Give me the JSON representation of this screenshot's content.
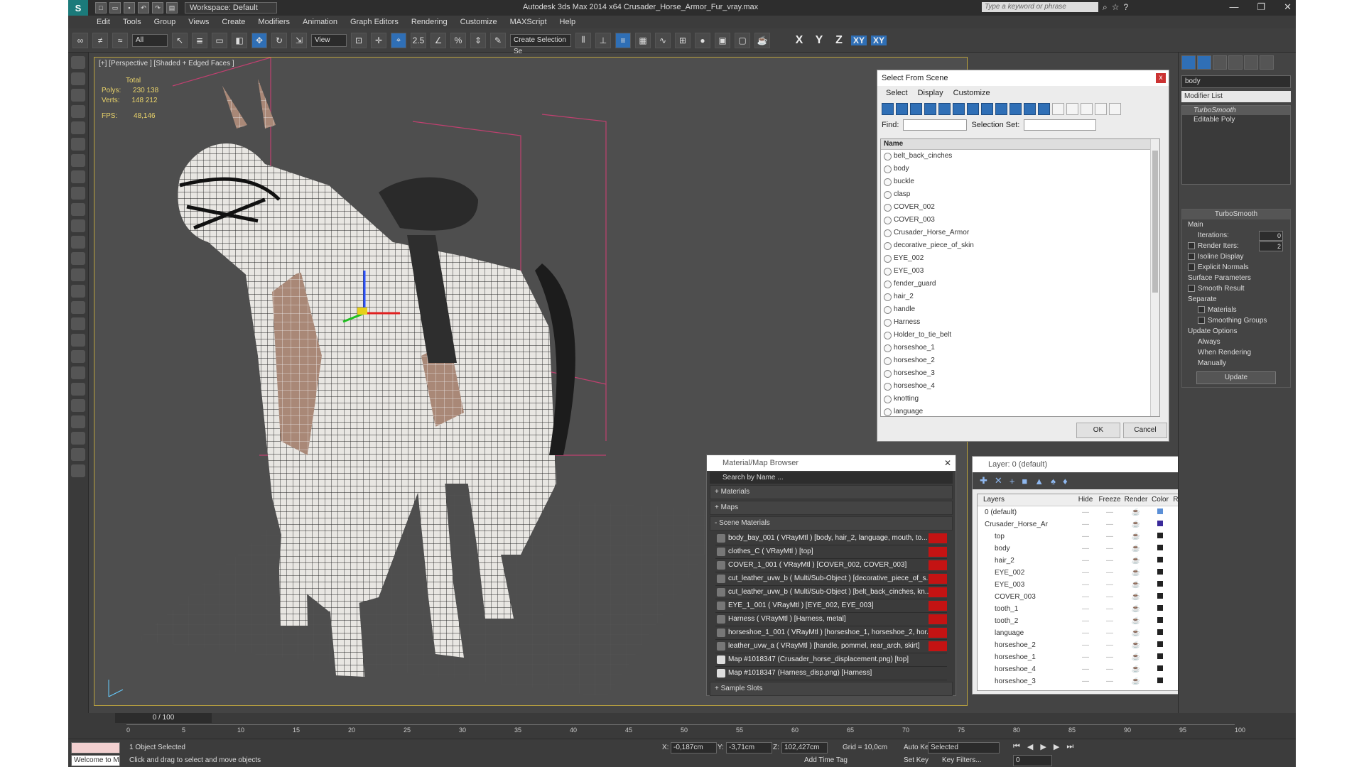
{
  "app": {
    "logo": "S",
    "workspace_label": "Workspace: Default",
    "title": "Autodesk 3ds Max  2014 x64     Crusader_Horse_Armor_Fur_vray.max",
    "search_placeholder": "Type a keyword or phrase",
    "titlebar_icons": [
      "binoculars-icon",
      "star-icon",
      "help-icon"
    ]
  },
  "menu": [
    "Edit",
    "Tools",
    "Group",
    "Views",
    "Create",
    "Modifiers",
    "Animation",
    "Graph Editors",
    "Rendering",
    "Customize",
    "MAXScript",
    "Help"
  ],
  "toolbar": {
    "filter": "All",
    "ref_coord": "View",
    "snap_labels": [
      "2.5",
      "%"
    ],
    "selection_set_placeholder": "Create Selection Se",
    "axes": [
      "X",
      "Y",
      "Z",
      "XY",
      "XY"
    ]
  },
  "viewport": {
    "label": "[+] [Perspective ] [Shaded + Edged Faces ]",
    "stats_header": "Total",
    "polys_label": "Polys:",
    "polys": "230 138",
    "verts_label": "Verts:",
    "verts": "148 212",
    "fps_label": "FPS:",
    "fps": "48,146"
  },
  "select_from_scene": {
    "title": "Select From Scene",
    "close": "x",
    "menu": [
      "Select",
      "Display",
      "Customize"
    ],
    "find_label": "Find:",
    "selection_set_label": "Selection Set:",
    "column": "Name",
    "items": [
      "belt_back_cinches",
      "body",
      "buckle",
      "clasp",
      "COVER_002",
      "COVER_003",
      "Crusader_Horse_Armor",
      "decorative_piece_of_skin",
      "EYE_002",
      "EYE_003",
      "fender_guard",
      "hair_2",
      "handle",
      "Harness",
      "Holder_to_tie_belt",
      "horseshoe_1",
      "horseshoe_2",
      "horseshoe_3",
      "horseshoe_4",
      "knotting",
      "language"
    ],
    "ok": "OK",
    "cancel": "Cancel"
  },
  "material_browser": {
    "title": "Material/Map Browser",
    "close": "✕",
    "search_placeholder": "Search by Name ...",
    "sections": [
      "+ Materials",
      "+ Maps",
      "- Scene Materials"
    ],
    "materials": [
      "body_bay_001 ( VRayMtl ) [body, hair_2, language, mouth, to...",
      "clothes_C ( VRayMtl ) [top]",
      "COVER_1_001 ( VRayMtl ) [COVER_002, COVER_003]",
      "cut_leather_uvw_b ( Multi/Sub-Object ) [decorative_piece_of_s...",
      "cut_leather_uvw_b ( Multi/Sub-Object ) [belt_back_cinches, kn...",
      "EYE_1_001 ( VRayMtl ) [EYE_002, EYE_003]",
      "Harness ( VRayMtl ) [Harness, metal]",
      "horseshoe_1_001 ( VRayMtl ) [horseshoe_1, horseshoe_2, hor...",
      "leather_uvw_a ( VRayMtl ) [handle, pommel, rear_arch, skirt]"
    ],
    "maps": [
      "Map #1018347 (Crusader_horse_displacement.png) [top]",
      "Map #1018347 (Harness_disp.png) [Harness]"
    ],
    "sample_slots": "+ Sample Slots"
  },
  "layer_dialog": {
    "title": "Layer: 0 (default)",
    "help": "?",
    "close": "✕",
    "tool_icons": [
      "✚",
      "✕",
      "+",
      "■",
      "▲",
      "♠",
      "♦"
    ],
    "columns": [
      "Layers",
      "Hide",
      "Freeze",
      "Render",
      "Color",
      "Radiosity"
    ],
    "rows": [
      {
        "name": "0 (default)",
        "color": "#5b8fd6"
      },
      {
        "name": "Crusader_Horse_Ar",
        "color": "#3a2a9a"
      },
      {
        "name": "top",
        "color": "#222222"
      },
      {
        "name": "body",
        "color": "#222222"
      },
      {
        "name": "hair_2",
        "color": "#222222"
      },
      {
        "name": "EYE_002",
        "color": "#222222"
      },
      {
        "name": "EYE_003",
        "color": "#222222"
      },
      {
        "name": "COVER_003",
        "color": "#222222"
      },
      {
        "name": "tooth_1",
        "color": "#222222"
      },
      {
        "name": "tooth_2",
        "color": "#222222"
      },
      {
        "name": "language",
        "color": "#222222"
      },
      {
        "name": "horseshoe_2",
        "color": "#222222"
      },
      {
        "name": "horseshoe_1",
        "color": "#222222"
      },
      {
        "name": "horseshoe_4",
        "color": "#222222"
      },
      {
        "name": "horseshoe_3",
        "color": "#222222"
      }
    ]
  },
  "command_panel": {
    "object_name": "body",
    "modifier_list": "Modifier List",
    "stack": [
      "TurboSmooth",
      "Editable Poly"
    ],
    "rollout_title": "TurboSmooth",
    "main_label": "Main",
    "iterations_label": "Iterations:",
    "iterations": "0",
    "render_iters_label": "Render Iters:",
    "render_iters": "2",
    "isoline": "Isoline Display",
    "explicit_normals": "Explicit Normals",
    "surface_params": "Surface Parameters",
    "smooth_result": "Smooth Result",
    "separate": "Separate",
    "materials": "Materials",
    "smoothing_groups": "Smoothing Groups",
    "update_options": "Update Options",
    "always": "Always",
    "when_rendering": "When Rendering",
    "manually": "Manually",
    "update_btn": "Update"
  },
  "timeline": {
    "frame": "0 / 100",
    "ticks": [
      "0",
      "5",
      "10",
      "15",
      "20",
      "25",
      "30",
      "35",
      "40",
      "45",
      "50",
      "55",
      "60",
      "65",
      "70",
      "75",
      "80",
      "85",
      "90",
      "95",
      "100"
    ]
  },
  "status": {
    "maxscript": "Welcome to M",
    "selected": "1 Object Selected",
    "prompt": "Click and drag to select and move objects",
    "x_label": "X:",
    "x": "-0,187cm",
    "y_label": "Y:",
    "y": "-3,71cm",
    "z_label": "Z:",
    "z": "102,427cm",
    "grid": "Grid = 10,0cm",
    "add_time_tag": "Add Time Tag",
    "auto_key": "Auto Key",
    "set_key": "Set Key",
    "selected_filter": "Selected",
    "key_filters": "Key Filters...",
    "frame_field": "0"
  }
}
